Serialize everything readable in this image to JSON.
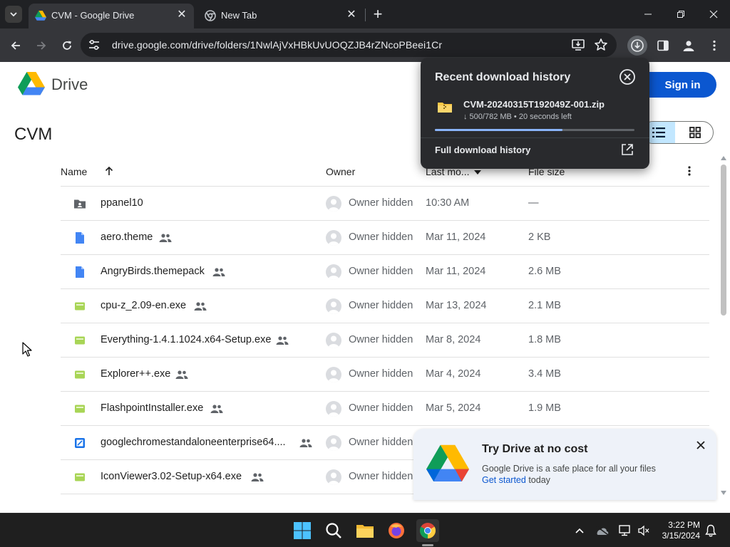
{
  "browser": {
    "tabs": [
      {
        "title": "CVM - Google Drive",
        "active": true,
        "icon": "google-drive-icon"
      },
      {
        "title": "New Tab",
        "active": false,
        "icon": "chrome-icon"
      }
    ],
    "url": "drive.google.com/drive/folders/1NwlAjVxHBkUvUOQZJB4rZNcoPBeei1Cr"
  },
  "drive": {
    "app_name": "Drive",
    "sign_in_label": "Sign in",
    "folder_title": "CVM",
    "columns": {
      "name": "Name",
      "owner": "Owner",
      "last_modified": "Last mo...",
      "file_size": "File size"
    },
    "files": [
      {
        "name": "ppanel10",
        "type": "shared-folder",
        "shared": false,
        "owner": "Owner hidden",
        "modified": "10:30 AM",
        "size": "—"
      },
      {
        "name": "aero.theme",
        "type": "doc",
        "shared": true,
        "owner": "Owner hidden",
        "modified": "Mar 11, 2024",
        "size": "2 KB"
      },
      {
        "name": "AngryBirds.themepack",
        "type": "doc",
        "shared": true,
        "owner": "Owner hidden",
        "modified": "Mar 11, 2024",
        "size": "2.6 MB"
      },
      {
        "name": "cpu-z_2.09-en.exe",
        "type": "exe",
        "shared": true,
        "owner": "Owner hidden",
        "modified": "Mar 13, 2024",
        "size": "2.1 MB"
      },
      {
        "name": "Everything-1.4.1.1024.x64-Setup.exe",
        "type": "exe",
        "shared": true,
        "owner": "Owner hidden",
        "modified": "Mar 8, 2024",
        "size": "1.8 MB"
      },
      {
        "name": "Explorer++.exe",
        "type": "exe",
        "shared": true,
        "owner": "Owner hidden",
        "modified": "Mar 4, 2024",
        "size": "3.4 MB"
      },
      {
        "name": "FlashpointInstaller.exe",
        "type": "exe",
        "shared": true,
        "owner": "Owner hidden",
        "modified": "Mar 5, 2024",
        "size": "1.9 MB"
      },
      {
        "name": "googlechromestandaloneenterprise64....",
        "type": "msi",
        "shared": true,
        "owner": "Owner hidden",
        "modified": "",
        "size": ""
      },
      {
        "name": "IconViewer3.02-Setup-x64.exe",
        "type": "exe",
        "shared": true,
        "owner": "Owner hidden",
        "modified": "",
        "size": ""
      }
    ]
  },
  "download_bubble": {
    "title": "Recent download history",
    "file_name": "CVM-20240315T192049Z-001.zip",
    "status": "↓ 500/782 MB • 20 seconds left",
    "progress": 0.64,
    "full_history_label": "Full download history"
  },
  "promo": {
    "title": "Try Drive at no cost",
    "description": "Google Drive is a safe place for all your files",
    "link": "Get started",
    "suffix": " today"
  },
  "taskbar": {
    "time": "3:22 PM",
    "date": "3/15/2024"
  },
  "colors": {
    "chrome_dark": "#202124",
    "chrome_toolbar": "#35363a",
    "drive_blue": "#0b57d0",
    "progress": "#8ab4f8",
    "exe_green": "#a8d556",
    "doc_blue": "#4285f4"
  }
}
